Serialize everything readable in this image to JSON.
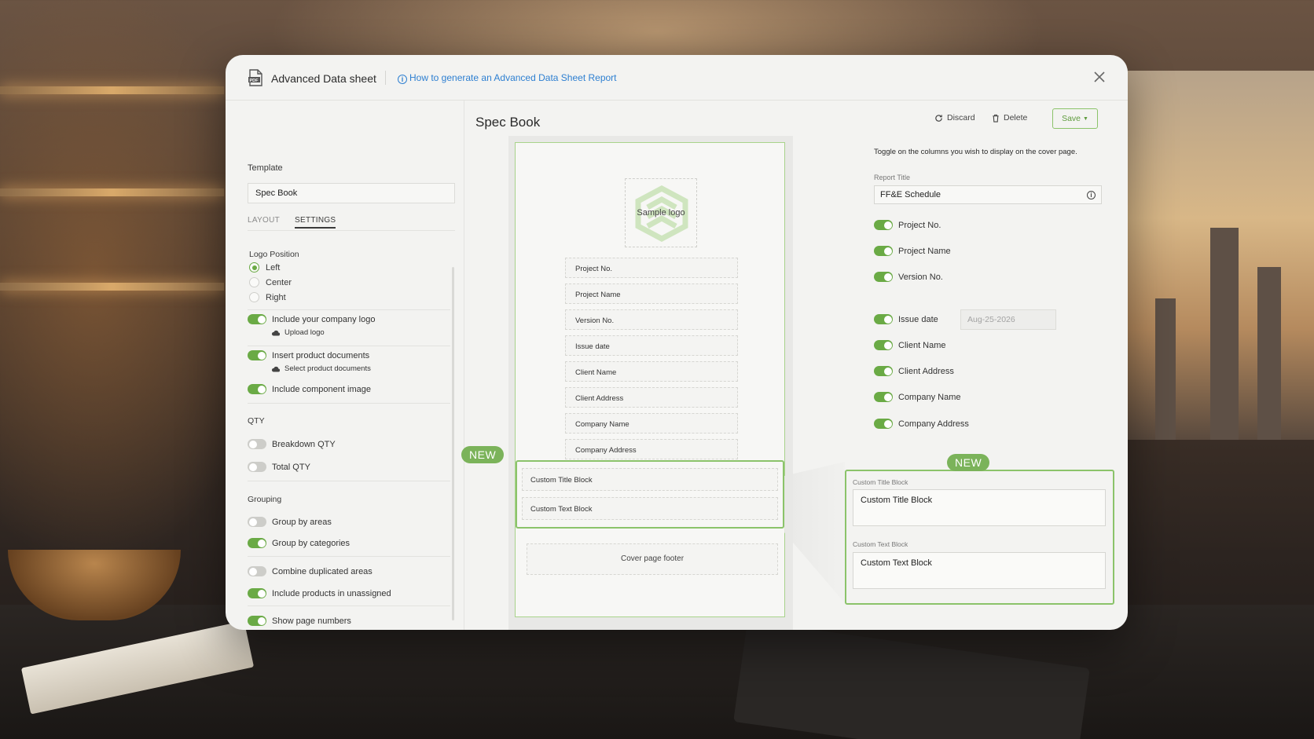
{
  "modal": {
    "title": "Advanced Data sheet",
    "help_link": "How to generate an Advanced Data Sheet Report"
  },
  "left": {
    "template_label": "Template",
    "template_value": "Spec Book",
    "tabs": [
      "LAYOUT",
      "SETTINGS"
    ],
    "active_tab": "SETTINGS",
    "logo_position_label": "Logo Position",
    "logo_positions": [
      "Left",
      "Center",
      "Right"
    ],
    "logo_position_selected": "Left",
    "include_logo": "Include your company logo",
    "upload_logo": "Upload logo",
    "insert_docs": "Insert product documents",
    "select_docs": "Select product documents",
    "include_component": "Include component image",
    "qty_label": "QTY",
    "breakdown_qty": "Breakdown QTY",
    "total_qty": "Total QTY",
    "grouping_label": "Grouping",
    "group_areas": "Group by areas",
    "group_categories": "Group by categories",
    "combine_areas": "Combine duplicated areas",
    "include_unassigned": "Include products in unassigned",
    "show_page_numbers": "Show page numbers",
    "toggles": {
      "include_logo": true,
      "insert_docs": true,
      "include_component": true,
      "breakdown_qty": false,
      "total_qty": false,
      "group_areas": false,
      "group_categories": true,
      "combine_areas": false,
      "include_unassigned": true,
      "show_page_numbers": true
    }
  },
  "preview": {
    "title": "Spec Book",
    "logo_text": "Sample logo",
    "fields": [
      "Project No.",
      "Project Name",
      "Version No.",
      "Issue date",
      "Client Name",
      "Client Address",
      "Company Name",
      "Company Address"
    ],
    "custom_title": "Custom Title Block",
    "custom_text": "Custom Text Block",
    "footer": "Cover page footer",
    "new_badge": "NEW"
  },
  "right": {
    "discard": "Discard",
    "delete": "Delete",
    "save": "Save",
    "hint": "Toggle on the columns you wish to display on the cover page.",
    "report_title_label": "Report Title",
    "report_title_value": "FF&E Schedule",
    "columns": [
      "Project No.",
      "Project Name",
      "Version No.",
      "Issue date",
      "Client Name",
      "Client Address",
      "Company Name",
      "Company Address"
    ],
    "issue_date_value": "Aug-25-2026",
    "new_badge": "NEW",
    "custom_title_label": "Custom Title Block",
    "custom_title_value": "Custom Title Block",
    "custom_text_label": "Custom Text Block",
    "custom_text_value": "Custom Text Block"
  },
  "colors": {
    "accent_green": "#6aaa45",
    "link_blue": "#2d7fd1"
  }
}
